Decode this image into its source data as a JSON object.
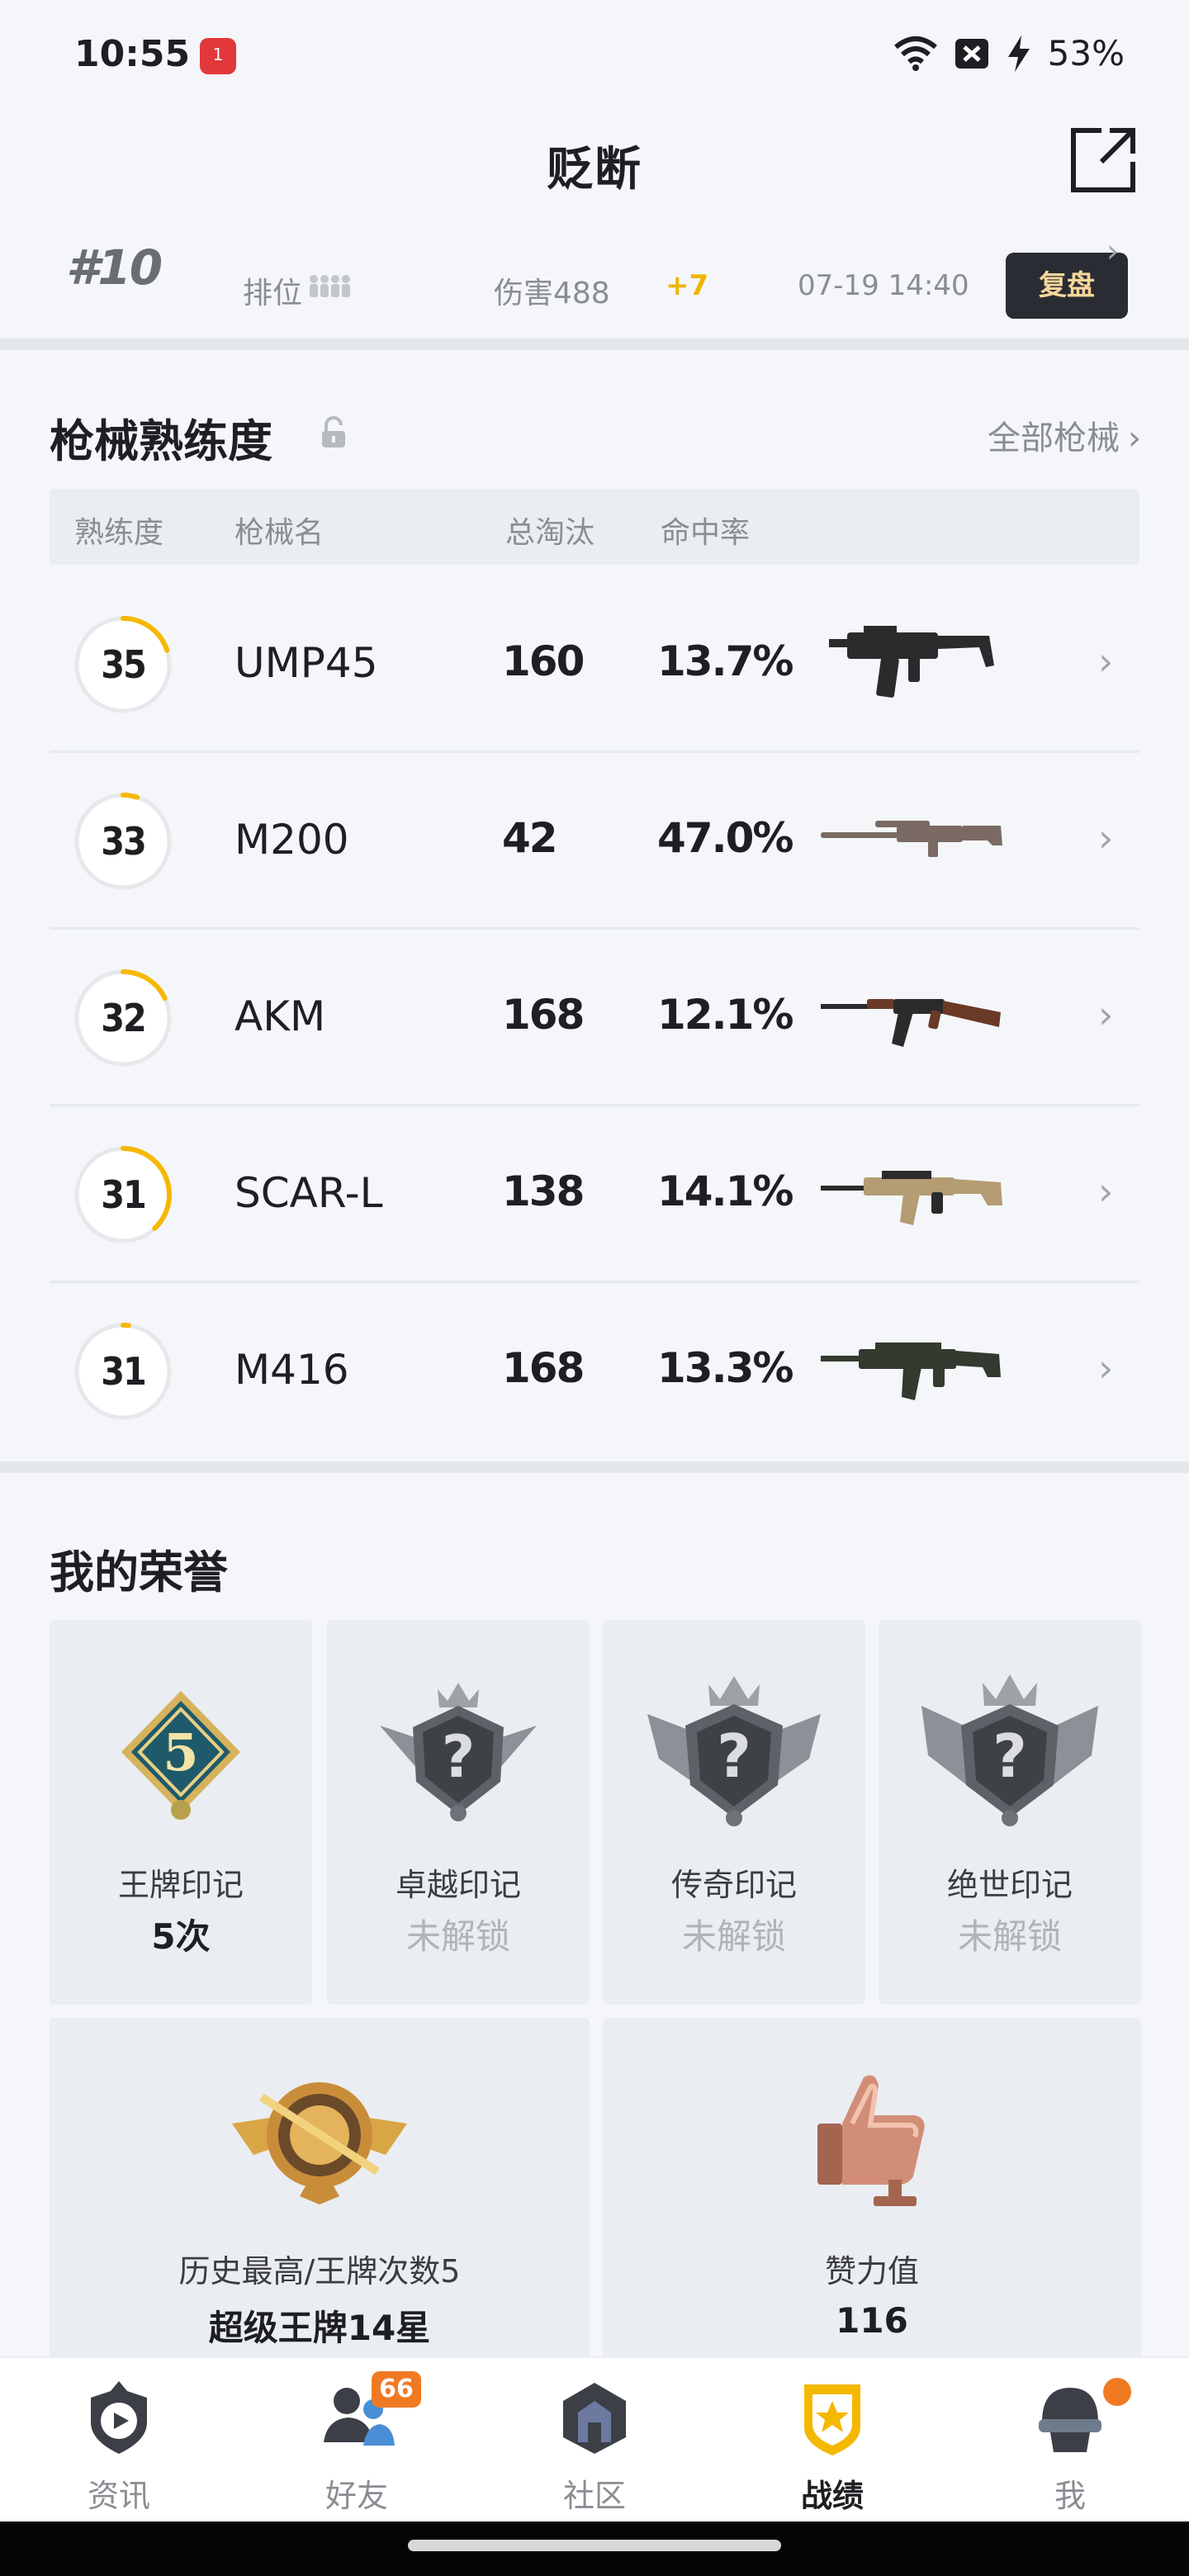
{
  "status_bar": {
    "time": "10:55",
    "notification_count": "1",
    "battery": "53%",
    "icons": [
      "wifi-icon",
      "no-sim-icon",
      "charging-icon"
    ]
  },
  "header": {
    "title": "贬断",
    "share_icon": "share-external-icon"
  },
  "recent_match": {
    "rank": "#10",
    "mode": "排位",
    "damage": "伤害488",
    "score_change": "+7",
    "time": "07-19 14:40",
    "replay_label": "复盘"
  },
  "weapon_mastery": {
    "title": "枪械熟练度",
    "all_link": "全部枪械",
    "columns": {
      "mastery": "熟练度",
      "name": "枪械名",
      "kills": "总淘汰",
      "accuracy": "命中率"
    },
    "rows": [
      {
        "level": "35",
        "progress": 0.2,
        "name": "UMP45",
        "kills": "160",
        "accuracy": "13.7%",
        "gun": "smg"
      },
      {
        "level": "33",
        "progress": 0.05,
        "name": "M200",
        "kills": "42",
        "accuracy": "47.0%",
        "gun": "sniper"
      },
      {
        "level": "32",
        "progress": 0.18,
        "name": "AKM",
        "kills": "168",
        "accuracy": "12.1%",
        "gun": "ak"
      },
      {
        "level": "31",
        "progress": 0.38,
        "name": "SCAR-L",
        "kills": "138",
        "accuracy": "14.1%",
        "gun": "scar"
      },
      {
        "level": "31",
        "progress": 0.02,
        "name": "M416",
        "kills": "168",
        "accuracy": "13.3%",
        "gun": "m416"
      }
    ]
  },
  "honors": {
    "title": "我的荣誉",
    "marks": [
      {
        "label": "王牌印记",
        "value": "5次",
        "badge": "ace-mark-badge",
        "locked": false,
        "badge_number": "5"
      },
      {
        "label": "卓越印记",
        "value": "未解锁",
        "badge": "excellence-mark-badge",
        "locked": true
      },
      {
        "label": "传奇印记",
        "value": "未解锁",
        "badge": "legend-mark-badge",
        "locked": true
      },
      {
        "label": "绝世印记",
        "value": "未解锁",
        "badge": "peerless-mark-badge",
        "locked": true
      }
    ],
    "history": {
      "label": "历史最高/王牌次数5",
      "value": "超级王牌14星"
    },
    "likes": {
      "label": "赞力值",
      "value": "116"
    }
  },
  "bottom_nav": {
    "items": [
      {
        "label": "资讯",
        "icon": "news-icon",
        "active": false
      },
      {
        "label": "好友",
        "icon": "friends-icon",
        "active": false,
        "badge": "66"
      },
      {
        "label": "社区",
        "icon": "community-icon",
        "active": false
      },
      {
        "label": "战绩",
        "icon": "record-icon",
        "active": true
      },
      {
        "label": "我",
        "icon": "profile-icon",
        "active": false,
        "dot": true
      }
    ]
  },
  "colors": {
    "accent_yellow": "#f5b800",
    "badge_orange": "#f07a22",
    "background": "#f4f6f9",
    "tile": "#eaedf1"
  }
}
